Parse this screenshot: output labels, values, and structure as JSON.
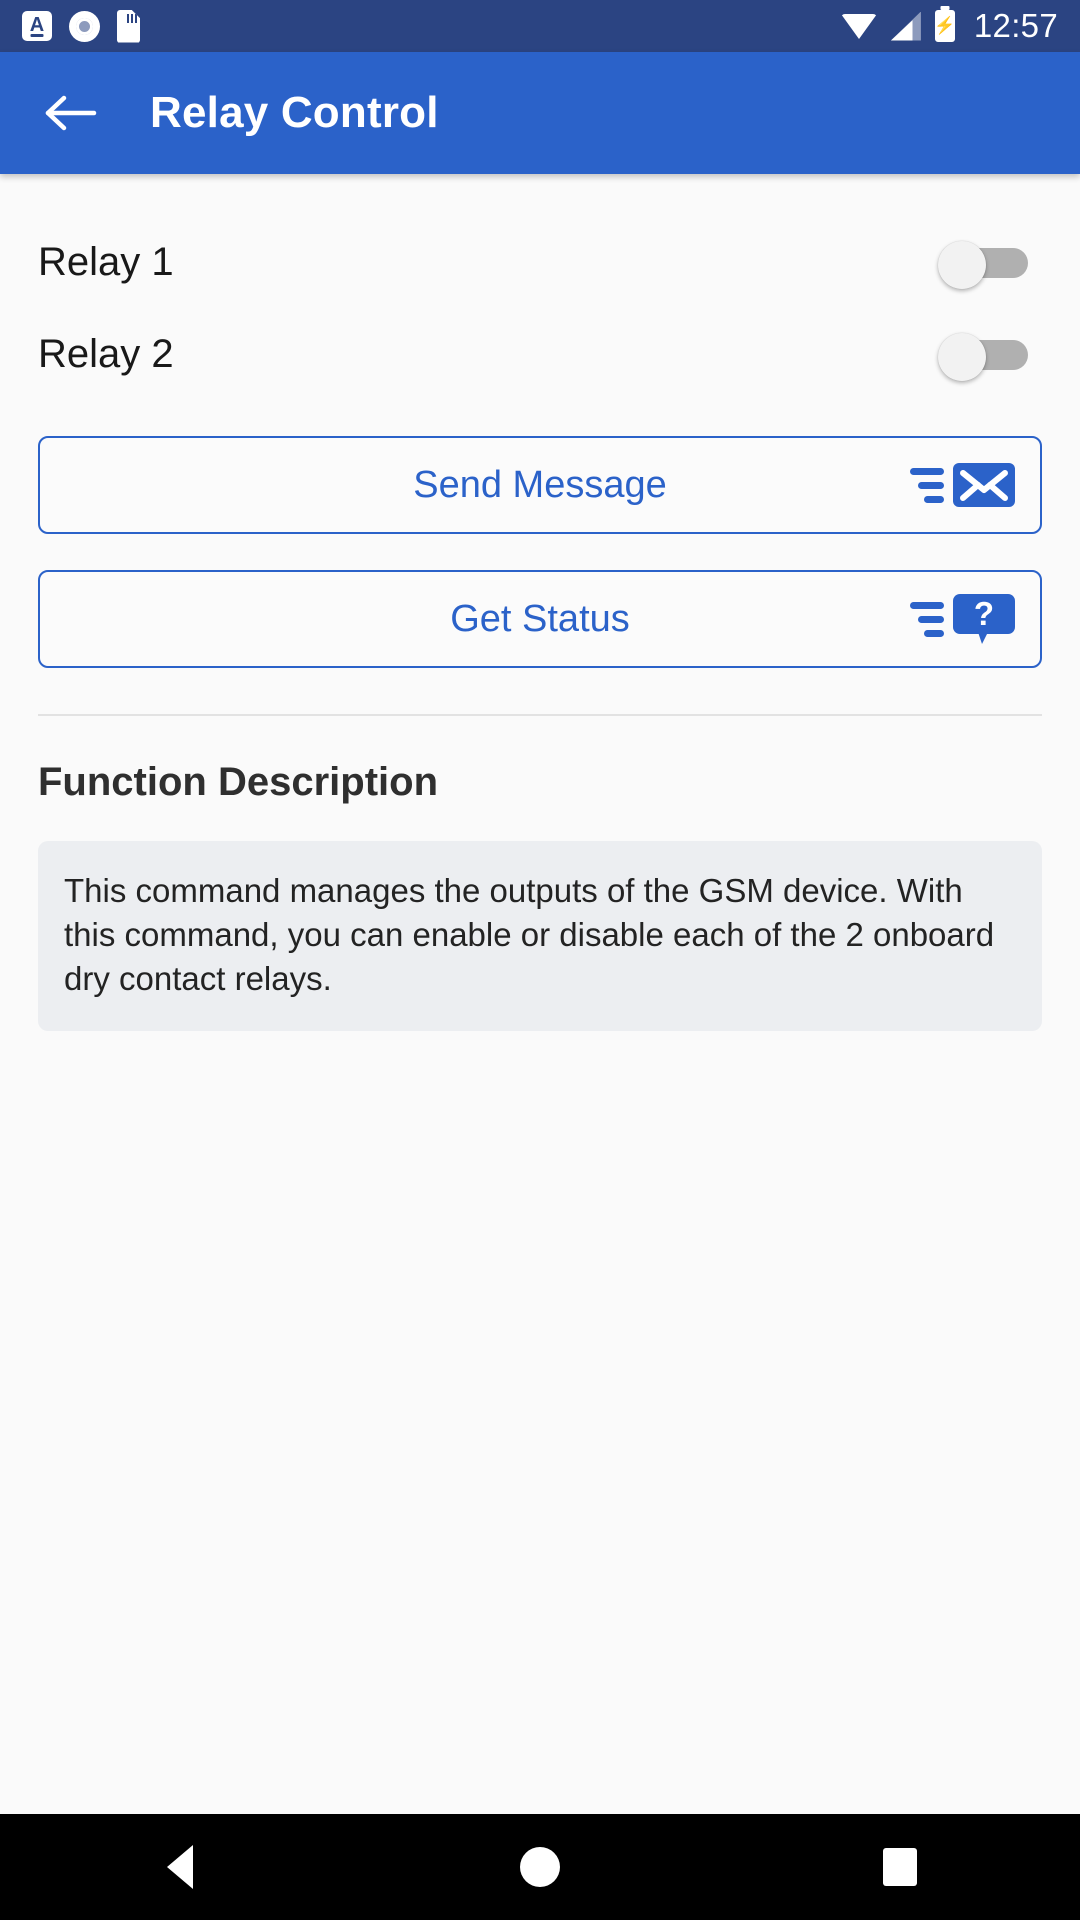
{
  "status_bar": {
    "time": "12:57",
    "icons": [
      "keyboard-a-icon",
      "record-circle-icon",
      "sdcard-icon",
      "wifi-icon",
      "cellular-signal-icon",
      "battery-charging-icon"
    ],
    "background_color": "#2b4482"
  },
  "app_bar": {
    "back_label": "back-arrow",
    "title": "Relay Control",
    "background_color": "#2b62c9"
  },
  "relays": [
    {
      "label": "Relay 1",
      "state": "off"
    },
    {
      "label": "Relay 2",
      "state": "off"
    }
  ],
  "buttons": [
    {
      "label": "Send Message",
      "icon": "send-message-envelope-icon"
    },
    {
      "label": "Get Status",
      "icon": "question-bubble-icon"
    }
  ],
  "description": {
    "heading": "Function Description",
    "body": "This command manages the outputs of the GSM device. With this command, you can enable or disable each of the 2 onboard dry contact relays."
  },
  "nav_bar": {
    "back": "back-triangle",
    "home": "home-circle",
    "recents": "recents-square"
  },
  "accent_color": "#2b62c9"
}
